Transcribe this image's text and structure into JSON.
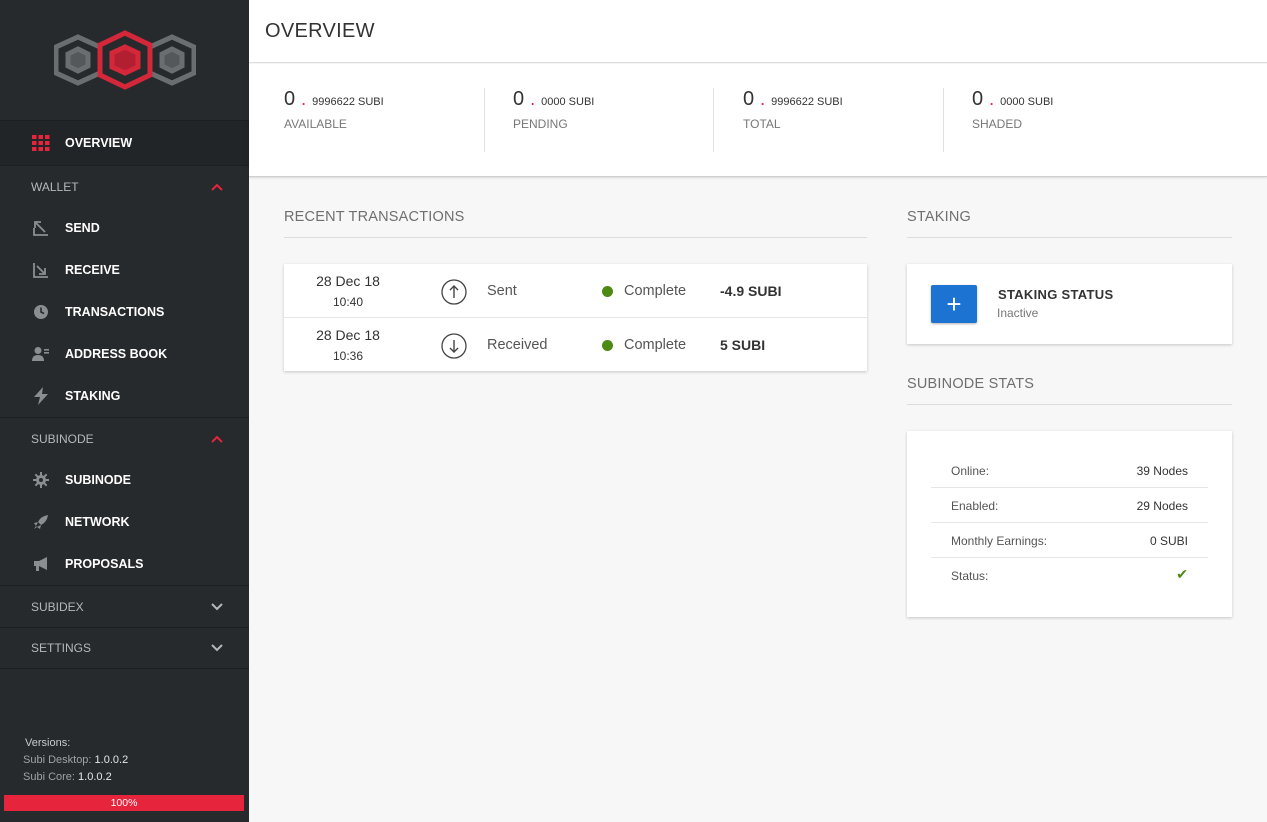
{
  "sidebar": {
    "overview": "OVERVIEW",
    "wallet_section": "WALLET",
    "wallet_items": [
      "SEND",
      "RECEIVE",
      "TRANSACTIONS",
      "ADDRESS BOOK",
      "STAKING"
    ],
    "subinode_section": "SUBINODE",
    "subinode_items": [
      "SUBINODE",
      "NETWORK",
      "PROPOSALS"
    ],
    "subidex_section": "SUBIDEX",
    "settings_section": "SETTINGS",
    "versions_label": "Versions:",
    "desktop_label": "Subi Desktop:",
    "desktop_version": "1.0.0.2",
    "core_label": "Subi Core:",
    "core_version": "1.0.0.2",
    "progress": "100%"
  },
  "page_title": "OVERVIEW",
  "balances": [
    {
      "int": "0",
      "dec": "9996622 SUBI",
      "label": "AVAILABLE"
    },
    {
      "int": "0",
      "dec": "0000 SUBI",
      "label": "PENDING"
    },
    {
      "int": "0",
      "dec": "9996622 SUBI",
      "label": "TOTAL"
    },
    {
      "int": "0",
      "dec": "0000 SUBI",
      "label": "SHADED"
    }
  ],
  "recent_transactions": {
    "title": "RECENT TRANSACTIONS",
    "rows": [
      {
        "date": "28 Dec 18",
        "time": "10:40",
        "type": "Sent",
        "status": "Complete",
        "amount": "-4.9 SUBI"
      },
      {
        "date": "28 Dec 18",
        "time": "10:36",
        "type": "Received",
        "status": "Complete",
        "amount": "5 SUBI"
      }
    ]
  },
  "staking": {
    "title": "STAKING",
    "button": "+",
    "status_title": "STAKING STATUS",
    "status_value": "Inactive"
  },
  "subinode_stats": {
    "title": "SUBINODE STATS",
    "rows": [
      {
        "key": "Online:",
        "value": "39 Nodes"
      },
      {
        "key": "Enabled:",
        "value": "29 Nodes"
      },
      {
        "key": "Monthly Earnings:",
        "value": "0 SUBI"
      },
      {
        "key": "Status:",
        "value": "✔"
      }
    ]
  },
  "colors": {
    "accent_red": "#e6243b",
    "sidebar_bg": "#262a2c",
    "primary_blue": "#1c73d1",
    "status_green": "#4c8a13"
  }
}
